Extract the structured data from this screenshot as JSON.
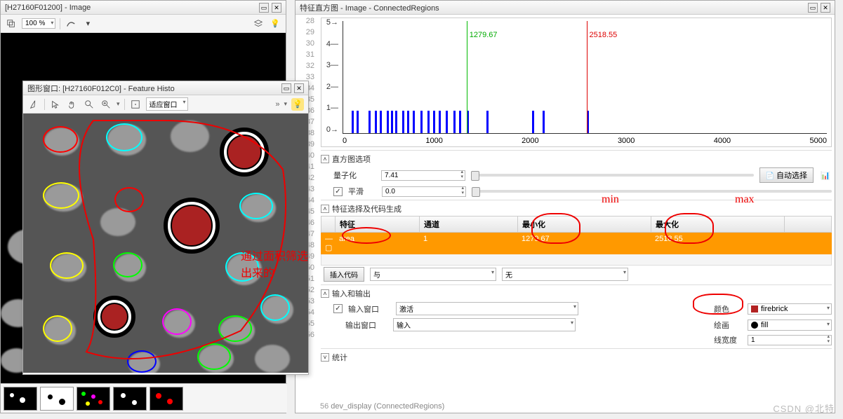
{
  "left_window": {
    "title": "[H27160F01200] - Image",
    "zoom": "100 %"
  },
  "histo_window": {
    "title": "图形窗口: [H27160F012C0] - Feature Histo",
    "fit_label": "适应窗口",
    "annotation": "通过面积筛选出来的"
  },
  "right_window": {
    "title": "特征直方图 - Image - ConnectedRegions",
    "line_numbers": [
      "28",
      "29",
      "30",
      "31",
      "32",
      "33",
      "34",
      "35",
      "36",
      "37",
      "38",
      "39",
      "40",
      "41",
      "42",
      "43",
      "44",
      "45",
      "46",
      "47",
      "48",
      "49",
      "50",
      "51",
      "52",
      "53",
      "54",
      "55",
      "56"
    ],
    "sections": {
      "hist_options": "直方图选项",
      "quantize": "量子化",
      "quantize_val": "7.41",
      "auto_select": "自动选择",
      "smooth": "平滑",
      "smooth_val": "0.0",
      "feature_sel": "特征选择及代码生成",
      "insert_code": "插入代码",
      "and": "与",
      "none": "无",
      "io": "输入和输出",
      "input_win": "输入窗口",
      "activate": "激活",
      "output_win": "输出窗口",
      "input": "输入",
      "color": "颜色",
      "color_val": "firebrick",
      "draw": "绘画",
      "draw_val": "fill",
      "linewidth": "线宽度",
      "linewidth_val": "1",
      "stats": "统计"
    },
    "table": {
      "headers": {
        "feature": "特征",
        "channel": "通道",
        "min": "最小化",
        "max": "最大化"
      },
      "row": {
        "feature": "area",
        "channel": "1",
        "min": "1279.67",
        "max": "2518.55"
      }
    },
    "annotations": {
      "min": "min",
      "max": "max"
    },
    "code": "dev_display (ConnectedRegions)"
  },
  "chart_data": {
    "type": "bar",
    "xlabel": "",
    "ylabel": "",
    "xticks": [
      0,
      1000,
      2000,
      3000,
      4000,
      5000
    ],
    "yticks": [
      0,
      1,
      2,
      3,
      4,
      5
    ],
    "ylim": [
      0,
      5
    ],
    "xlim": [
      0,
      5000
    ],
    "markers": [
      {
        "value": 1279.67,
        "color": "green",
        "label": "1279.67"
      },
      {
        "value": 2518.55,
        "color": "red",
        "label": "2518.55"
      }
    ],
    "bars": [
      90,
      140,
      260,
      330,
      380,
      450,
      490,
      540,
      610,
      660,
      720,
      800,
      870,
      930,
      990,
      1060,
      1140,
      1200,
      1280,
      1480,
      1950,
      2060,
      2520
    ]
  },
  "watermark": "CSDN @北特"
}
